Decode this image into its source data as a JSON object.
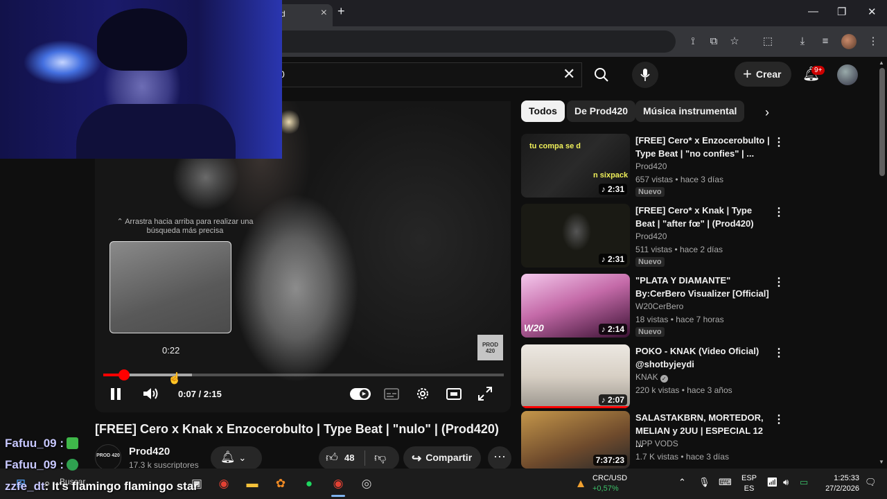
{
  "browser": {
    "tab_title": "d",
    "new_tab_icon": "+",
    "window_controls": [
      "—",
      "❐",
      "✕"
    ]
  },
  "youtube": {
    "search_value": "0",
    "create_label": "Crear",
    "notification_count": "9+"
  },
  "chips": [
    "Todos",
    "De Prod420",
    "Música instrumental"
  ],
  "player": {
    "drag_hint": "⌃ Arrastra hacia arriba para realizar una búsqueda más precisa",
    "preview_time": "0:22",
    "time_display": "0:07 / 2:15",
    "progress_fraction": 0.052,
    "watermark": "PROD 420"
  },
  "video": {
    "title": "[FREE] Cero x Knak x Enzocerobulto | Type Beat | \"nulo\" | (Prod420)",
    "channel_name": "Prod420",
    "channel_avatar_text": "PROD 420",
    "subscribers": "17.3 k suscriptores",
    "likes": "48",
    "share_label": "Compartir"
  },
  "recommendations": [
    {
      "title": "[FREE] Cero* x Enzocerobulto | Type Beat | \"no confies\" | ...",
      "channel": "Prod420",
      "meta": "657 vistas • hace 3 días",
      "badge": "Nuevo",
      "duration": "2:31",
      "thumb_caption": "tu compa se d",
      "thumb_caption2": "n sixpack"
    },
    {
      "title": "[FREE] Cero* x Knak | Type Beat | \"after fœ\" | (Prod420)",
      "channel": "Prod420",
      "meta": "511 vistas • hace 2 días",
      "badge": "Nuevo",
      "duration": "2:31"
    },
    {
      "title": "\"PLATA Y DIAMANTE\" By:CerBero Visualizer [Official]",
      "channel": "W20CerBero",
      "meta": "18 vistas • hace 7 horas",
      "badge": "Nuevo",
      "duration": "2:14",
      "thumb_logo": "W20"
    },
    {
      "title": "POKO - KNAK (Video Oficial) @shotbyjeydi",
      "channel": "KNAK",
      "meta": "220 k vistas • hace 3 años",
      "duration": "2:07"
    },
    {
      "title": "SALASTAKBRN, MORTEDOR, MELIAN y 2UU | ESPECIAL 12 ...",
      "channel": "NPP VODS",
      "meta": "1.7 K vistas • hace 3 días",
      "duration": "7:37:23"
    }
  ],
  "chat": [
    {
      "user": "Fafuu_09",
      "message": ""
    },
    {
      "user": "Fafuu_09",
      "message": ""
    },
    {
      "user": "zzfe_dt",
      "message": ": It's flamingo flamingo star"
    }
  ],
  "taskbar": {
    "search_placeholder": "Buscar",
    "stock_symbol": "CRC/USD",
    "stock_change": "+0,57%",
    "lang_top": "ESP",
    "lang_bottom": "ES",
    "time": "1:25:33",
    "date": "27/2/2026"
  },
  "colors": {
    "accent_red": "#ff0000",
    "background": "#0f0f0f",
    "chip_bg": "#272727"
  }
}
